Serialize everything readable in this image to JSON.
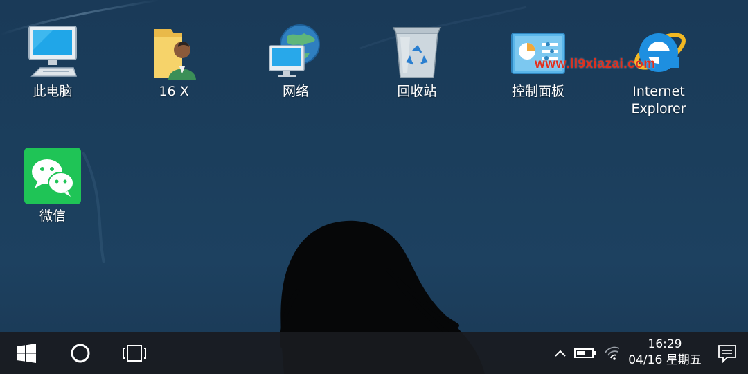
{
  "desktop_icons": [
    {
      "label": "此电脑",
      "icon": "computer-icon"
    },
    {
      "label": "16 X",
      "icon": "user-folder-icon"
    },
    {
      "label": "网络",
      "icon": "network-globe-icon"
    },
    {
      "label": "回收站",
      "icon": "recycle-bin-icon"
    },
    {
      "label": "控制面板",
      "icon": "control-panel-icon"
    },
    {
      "label": "Internet\nExplorer",
      "icon": "internet-explorer-icon"
    },
    {
      "label": "微信",
      "icon": "wechat-icon"
    }
  ],
  "watermark": "www.ll9xiazai.com",
  "taskbar": {
    "start_icon": "windows-start-icon",
    "search_icon": "cortana-circle-icon",
    "task_view_icon": "task-view-icon",
    "tray": {
      "chevron_icon": "chevron-up-icon",
      "battery_icon": "battery-icon",
      "wifi_icon": "wifi-icon",
      "notification_icon": "notification-icon"
    },
    "clock": {
      "time": "16:29",
      "date": "04/16 星期五"
    }
  },
  "colors": {
    "wallpaper": "#1b3e5c",
    "taskbar": "#191b20",
    "watermark": "#e0301e",
    "wechat_green": "#1fc456"
  }
}
